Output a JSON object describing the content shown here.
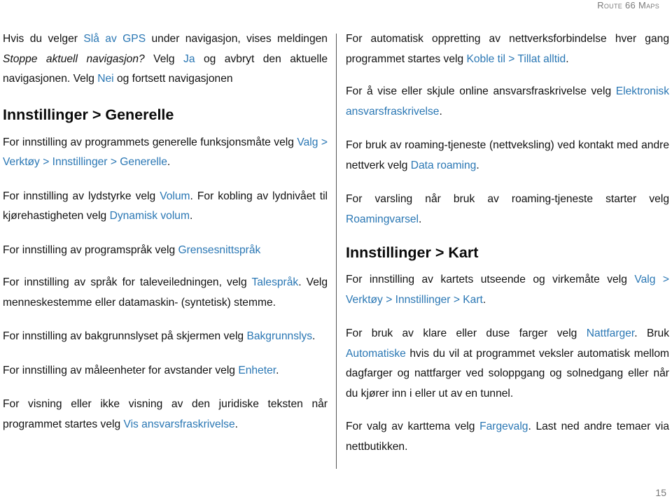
{
  "header": {
    "running_title": "Route 66 Maps"
  },
  "colors": {
    "link": "#2a77b4",
    "text": "#111111",
    "divider": "#555555"
  },
  "left_column": {
    "p1": {
      "t1": "Hvis du velger ",
      "link1": "Slå av GPS",
      "t2": " under navigasjon, vises meldingen ",
      "em1": "Stoppe aktuell navigasjon?",
      "t3": " Velg ",
      "link2": "Ja",
      "t4": " og avbryt den aktuelle navigasjonen. Velg ",
      "link3": "Nei",
      "t5": " og fortsett navigasjonen"
    },
    "heading1": "Innstillinger > Generelle",
    "p2": {
      "t1": "For innstilling av programmets generelle funksjonsmåte velg ",
      "link1": "Valg > Verktøy > Innstillinger > Generelle",
      "t2": "."
    },
    "p3": {
      "t1": "For innstilling av lydstyrke velg ",
      "link1": "Volum",
      "t2": ". For kobling av lydnivået til kjørehastigheten velg ",
      "link2": "Dynamisk volum",
      "t3": "."
    },
    "p4": {
      "t1": "For innstilling av programspråk velg ",
      "link1": "Grensesnittspråk"
    },
    "p5": {
      "t1": "For innstilling av språk for taleveiledningen, velg ",
      "link1": "Talespråk",
      "t2": ". Velg menneskestemme eller datamaskin- (syntetisk) stemme."
    },
    "p6": {
      "t1": "For innstilling av bakgrunnslyset på skjermen velg ",
      "link1": "Bakgrunnslys",
      "t2": "."
    },
    "p7": {
      "t1": "For innstilling av måleenheter for avstander velg ",
      "link1": "Enheter",
      "t2": "."
    },
    "p8": {
      "t1": "For visning eller ikke visning av den juridiske teksten når programmet startes velg ",
      "link1": "Vis ansvarsfraskrivelse",
      "t2": "."
    }
  },
  "right_column": {
    "p1": {
      "t1": "For automatisk oppretting av nettverksforbindelse hver gang programmet startes velg ",
      "link1": "Koble til > Tillat alltid",
      "t2": "."
    },
    "p2": {
      "t1": "For å vise eller skjule online ansvarsfraskrivelse velg ",
      "link1": "Elektronisk ansvarsfraskrivelse",
      "t2": "."
    },
    "p3": {
      "t1": "For bruk av roaming-tjeneste (nettveksling) ved kontakt med andre nettverk velg ",
      "link1": "Data roaming",
      "t2": "."
    },
    "p4": {
      "t1": "For varsling når bruk av roaming-tjeneste starter velg ",
      "link1": "Roamingvarsel",
      "t2": "."
    },
    "heading1": "Innstillinger > Kart",
    "p5": {
      "t1": "For innstilling av kartets utseende og virkemåte velg ",
      "link1": "Valg > Verktøy > Innstillinger > Kart",
      "t2": "."
    },
    "p6": {
      "t1": "For bruk av klare eller duse farger velg ",
      "link1": "Nattfarger",
      "t2": ". Bruk ",
      "link2": "Automatiske",
      "t3": " hvis du vil at programmet veksler automatisk mellom dagfarger og nattfarger ved soloppgang og solnedgang eller når du kjører inn i eller ut av en tunnel."
    },
    "p7": {
      "t1": "For valg av karttema velg ",
      "link1": "Fargevalg",
      "t2": ". Last ned andre temaer via nettbutikken."
    }
  },
  "footer": {
    "page_number": "15"
  }
}
